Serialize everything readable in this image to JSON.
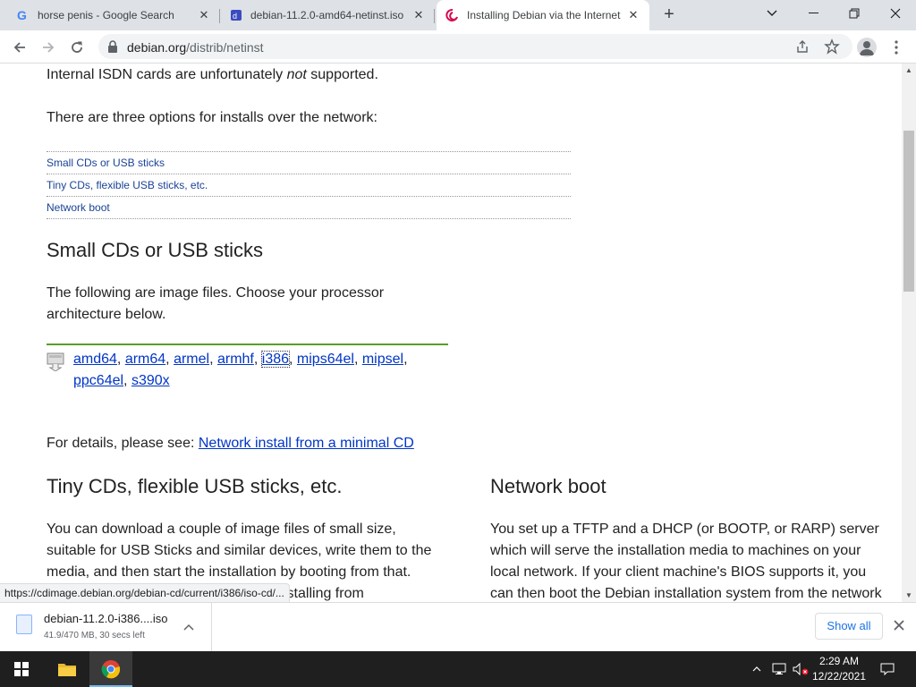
{
  "browser": {
    "tabs": [
      {
        "title": "horse penis - Google Search",
        "favicon": "google-icon"
      },
      {
        "title": "debian-11.2.0-amd64-netinst.iso",
        "favicon": "debian-dir-icon"
      },
      {
        "title": "Installing Debian via the Internet",
        "favicon": "debian-swirl-icon",
        "active": true
      }
    ],
    "url_host": "debian.org",
    "url_path": "/distrib/netinst"
  },
  "page": {
    "isdn_pre": "Internal ISDN cards are unfortunately ",
    "isdn_em": "not",
    "isdn_post": " supported.",
    "options_intro": "There are three options for installs over the network:",
    "toc": [
      "Small CDs or USB sticks",
      "Tiny CDs, flexible USB sticks, etc.",
      "Network boot"
    ],
    "small_heading": "Small CDs or USB sticks",
    "small_intro": "The following are image files. Choose your processor architecture below.",
    "architectures": [
      "amd64",
      "arm64",
      "armel",
      "armhf",
      "i386",
      "mips64el",
      "mipsel",
      "ppc64el",
      "s390x"
    ],
    "details_prefix": "For details, please see: ",
    "details_link": "Network install from a minimal CD",
    "tiny_heading": "Tiny CDs, flexible USB sticks, etc.",
    "tiny_text": "You can download a couple of image files of small size, suitable for USB Sticks and similar devices, write them to the media, and then start the installation by booting from that. There is some variety of support for installing from",
    "netboot_heading": "Network boot",
    "netboot_text": "You set up a TFTP and a DHCP (or BOOTP, or RARP) server which will serve the installation media to machines on your local network. If your client machine's BIOS supports it, you can then boot the Debian installation system from the network"
  },
  "status_url": "https://cdimage.debian.org/debian-cd/current/i386/iso-cd/...",
  "download": {
    "filename": "debian-11.2.0-i386....iso",
    "progress": "41.9/470 MB, 30 secs left",
    "show_all": "Show all"
  },
  "taskbar": {
    "time": "2:29 AM",
    "date": "12/22/2021"
  }
}
